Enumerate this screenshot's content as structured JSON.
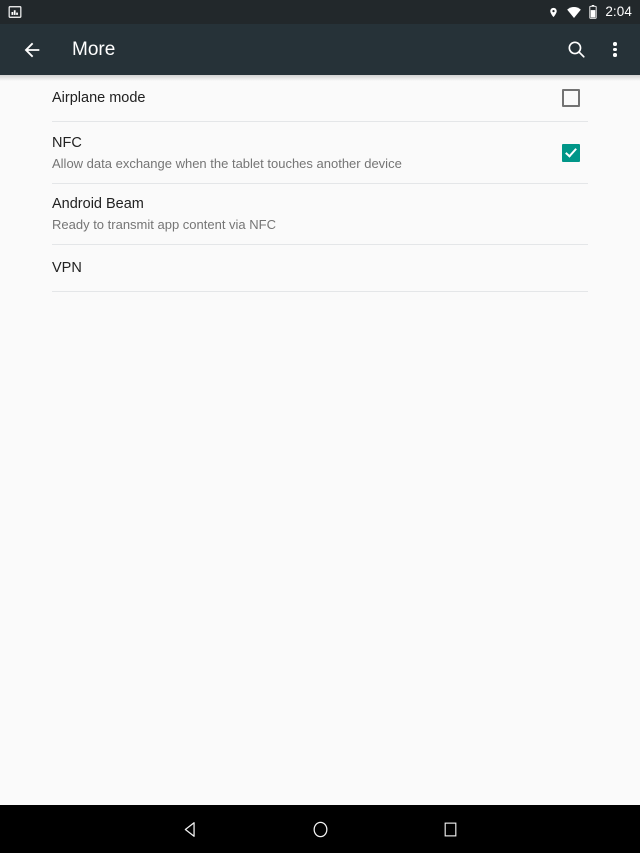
{
  "status_bar": {
    "left_icons": [
      {
        "name": "screenshot-notification-icon",
        "glyph": "image"
      }
    ],
    "right_icons": [
      {
        "name": "location-icon",
        "glyph": "pin"
      },
      {
        "name": "wifi-icon",
        "glyph": "wifi"
      },
      {
        "name": "battery-icon",
        "glyph": "battery"
      }
    ],
    "time": "2:04",
    "background_color": "#22282b"
  },
  "toolbar": {
    "title": "More",
    "back_icon": "arrow-left-icon",
    "search_icon": "search-icon",
    "overflow_icon": "overflow-menu-icon",
    "background_color": "#263238",
    "text_color": "#ffffff"
  },
  "settings": {
    "accent_color": "#009688",
    "checkbox_unchecked_color": "#737373",
    "rows": [
      {
        "title": "Airplane mode",
        "summary": "",
        "widget": "checkbox",
        "checked": false
      },
      {
        "title": "NFC",
        "summary": "Allow data exchange when the tablet touches another device",
        "widget": "checkbox",
        "checked": true
      },
      {
        "title": "Android Beam",
        "summary": "Ready to transmit app content via NFC",
        "widget": "none",
        "checked": false
      },
      {
        "title": "VPN",
        "summary": "",
        "widget": "none",
        "checked": false
      }
    ]
  },
  "nav_bar": {
    "background_color": "#000000",
    "buttons": [
      {
        "name": "nav-back-button",
        "glyph": "triangle-left"
      },
      {
        "name": "nav-home-button",
        "glyph": "circle"
      },
      {
        "name": "nav-recents-button",
        "glyph": "square"
      }
    ]
  }
}
